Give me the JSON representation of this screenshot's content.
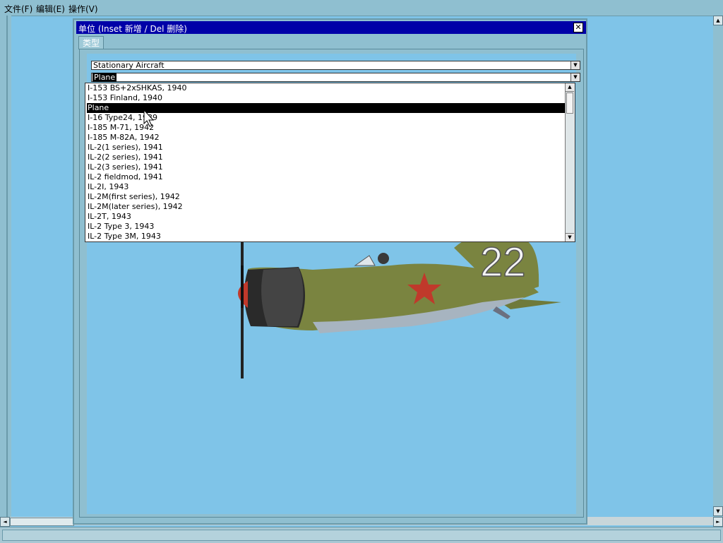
{
  "menubar": {
    "items": [
      {
        "label": "文件(F)"
      },
      {
        "label": "编辑(E)"
      },
      {
        "label": "操作(V)"
      }
    ]
  },
  "dialog": {
    "title": "单位 (Inset 新增 / Del 删除)",
    "close_glyph": "✕",
    "tab_label": "类型",
    "category_combo": {
      "value": "Stationary Aircraft"
    },
    "type_combo": {
      "value": "Plane"
    },
    "list": {
      "items": [
        "I-153 BS+2xSHKAS, 1940",
        "I-153 Finland, 1940",
        "Plane",
        "I-16 Type24, 1939",
        "I-185 M-71, 1942",
        "I-185 M-82A, 1942",
        "IL-2(1 series), 1941",
        "IL-2(2 series), 1941",
        "IL-2(3 series), 1941",
        "IL-2 fieldmod, 1941",
        "IL-2I, 1943",
        "IL-2M(first series), 1942",
        "IL-2M(later series), 1942",
        "IL-2T, 1943",
        "IL-2 Type 3, 1943",
        "IL-2 Type 3M, 1943"
      ],
      "selected_index": 2
    },
    "preview": {
      "tail_number": "22"
    }
  },
  "icons": {
    "scroll_up": "▲",
    "scroll_down": "▼",
    "scroll_left": "◄",
    "scroll_right": "►",
    "dropdown": "▼"
  },
  "colors": {
    "desktop": "#7fc4e8",
    "titlebar": "#0000a8",
    "frame": "#8fbfd0",
    "aircraft_body": "#7a8440",
    "star": "#c0392b"
  }
}
